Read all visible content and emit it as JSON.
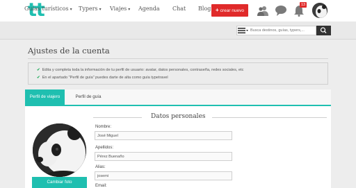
{
  "header": {
    "logo": "tt",
    "create_button": {
      "icon": "plus-icon",
      "label": "crear nuevo"
    },
    "icons": [
      "friends-icon",
      "chat-bubble-icon",
      "bell-icon",
      "user-avatar"
    ],
    "notification_count": "13",
    "accent_color": "#1fbfb0",
    "create_color": "#e02a2a"
  },
  "nav": {
    "items": [
      {
        "label": "Guías turísticos",
        "dropdown": true
      },
      {
        "label": "Typers",
        "dropdown": true
      },
      {
        "label": "Viajes",
        "dropdown": true
      },
      {
        "label": "Agenda",
        "dropdown": false
      },
      {
        "label": "Chat",
        "dropdown": false
      },
      {
        "label": "Blog",
        "dropdown": false
      }
    ],
    "caret": "▾",
    "search": {
      "placeholder": "Busca destinos, guías, typers,...",
      "menu_icon": "hamburger-icon",
      "button_icon": "search-icon"
    }
  },
  "page": {
    "title": "Ajustes de la cuenta",
    "info": [
      "Edita y completa toda la información de tu perfil de usuario: avatar, datos personales, contraseña, redes sociales, etc",
      "En el apartado \"Perfil de guía\" puedes darte de alta como guía typetravel"
    ],
    "check_glyph": "✔",
    "tabs": [
      {
        "label": "Perfil de viajero",
        "active": true
      },
      {
        "label": "Perfil de guía",
        "active": false
      }
    ],
    "section_title": "Datos personales",
    "photo_button": "Cambiar foto",
    "fields": [
      {
        "label": "Nombre:",
        "value": "José Miguel"
      },
      {
        "label": "Apellidos:",
        "value": "Pérez Buenaño"
      },
      {
        "label": "Alias:",
        "value": "josemi"
      },
      {
        "label": "Email:",
        "value": ""
      }
    ]
  }
}
